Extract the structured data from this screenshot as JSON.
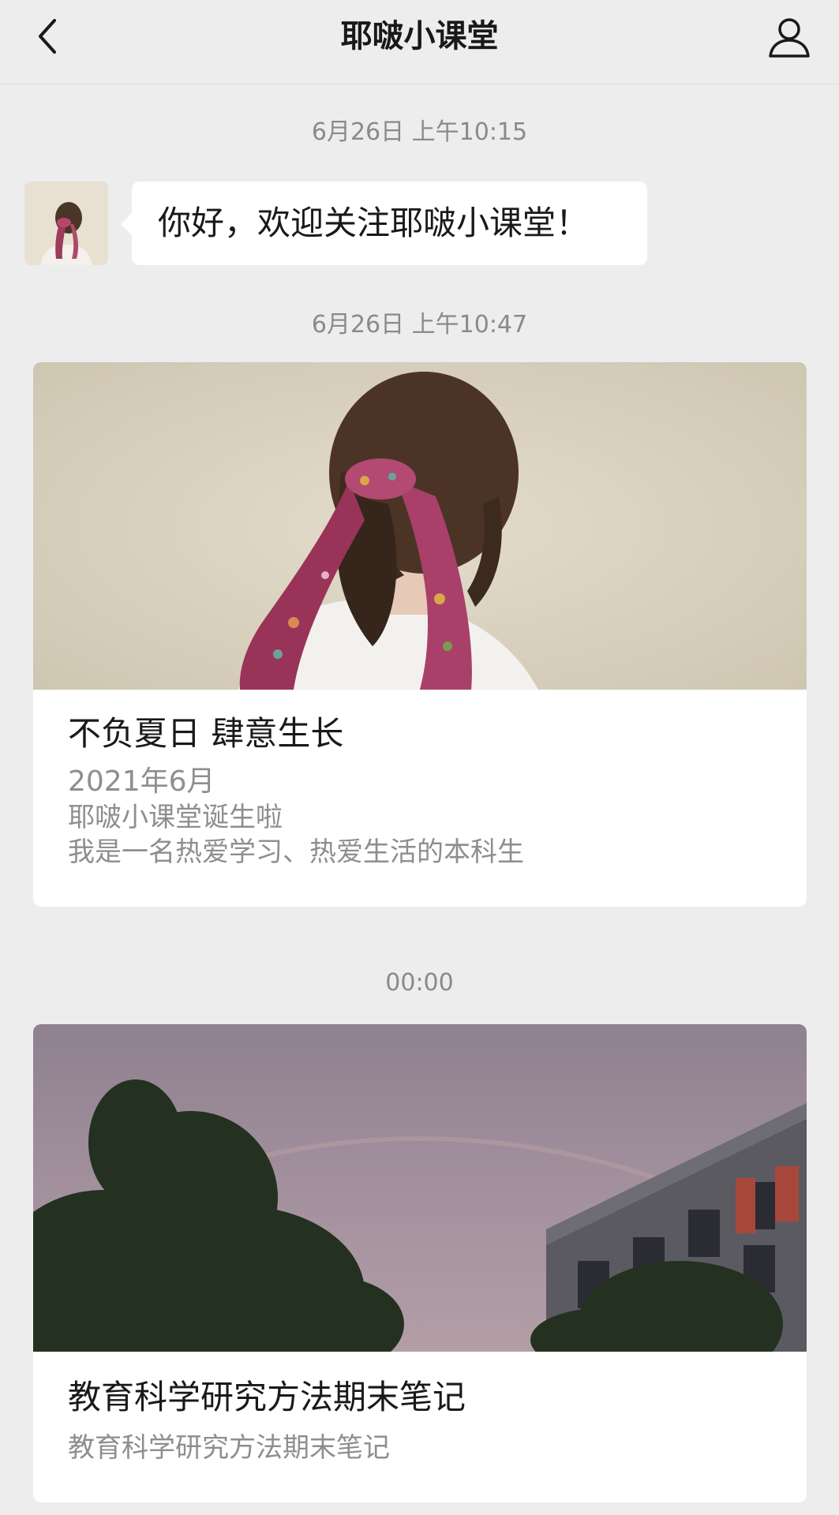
{
  "header": {
    "title": "耶啵小课堂",
    "back_icon": "chevron-left-icon",
    "profile_icon": "person-icon"
  },
  "chat": {
    "timestamp_1": "6月26日 上午10:15",
    "greeting": "你好，欢迎关注耶啵小课堂！",
    "timestamp_2": "6月26日 上午10:47",
    "timestamp_3": "00:00"
  },
  "articles": [
    {
      "title": "不负夏日 肆意生长",
      "desc_line1": "2021年6月",
      "desc_line2": "耶啵小课堂诞生啦",
      "desc_line3": "我是一名热爱学习、热爱生活的本科生"
    },
    {
      "title": "教育科学研究方法期末笔记",
      "desc": "教育科学研究方法期末笔记"
    }
  ],
  "colors": {
    "background": "#ededed",
    "card": "#ffffff",
    "timestamp": "#8a8a8a",
    "secondary_text": "#8e8e8e"
  }
}
